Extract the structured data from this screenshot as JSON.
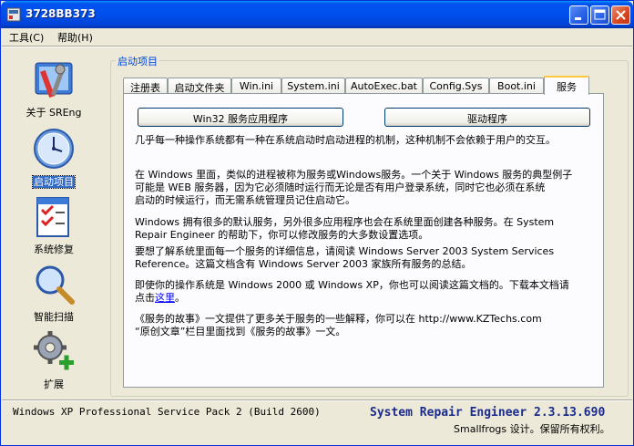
{
  "window": {
    "title": "3728BB373"
  },
  "menu": {
    "tools": "工具(C)",
    "help": "帮助(H)"
  },
  "sidebar": {
    "items": [
      {
        "label": "关于 SREng",
        "icon": "tools-icon"
      },
      {
        "label": "启动项目",
        "icon": "clock-icon"
      },
      {
        "label": "系统修复",
        "icon": "checklist-icon"
      },
      {
        "label": "智能扫描",
        "icon": "magnifier-icon"
      },
      {
        "label": "扩展",
        "icon": "gear-plus-icon"
      }
    ]
  },
  "group": {
    "label": "启动项目"
  },
  "tabs": [
    "注册表",
    "启动文件夹",
    "Win.ini",
    "System.ini",
    "AutoExec.bat",
    "Config.Sys",
    "Boot.ini",
    "服务"
  ],
  "buttons": {
    "win32": "Win32 服务应用程序",
    "driver": "驱动程序"
  },
  "content": {
    "p1": "几乎每一种操作系统都有一种在系统启动时启动进程的机制，这种机制不会依赖于用户的交互。",
    "p2a": "在 Windows 里面，类似的进程被称为服务或Windows服务。一个关于 Windows 服务的典型例子",
    "p2b": "可能是 WEB 服务器，因为它必须随时运行而无论是否有用户登录系统，同时它也必须在系统",
    "p2c": "启动的时候运行，而无需系统管理员记住启动它。",
    "p3a": "Windows 拥有很多的默认服务，另外很多应用程序也会在系统里面创建各种服务。在 System",
    "p3b": "Repair Engineer 的帮助下，你可以修改服务的大多数设置选项。",
    "p4a": "要想了解系统里面每一个服务的详细信息，请阅读 Windows Server 2003 System Services",
    "p4b": "Reference。这篇文档含有 Windows Server 2003 家族所有服务的总结。",
    "p5a": "即使你的操作系统是 Windows 2000 或 Windows XP，你也可以阅读这篇文档的。下载本文档请",
    "p5b_pre": "点击",
    "p5b_link": "这里",
    "p5b_post": "。",
    "p6a": "《服务的故事》一文提供了更多关于服务的一些解释，你可以在 http://www.KZTechs.com",
    "p6b": "“原创文章”栏目里面找到《服务的故事》一文。"
  },
  "status": {
    "os": "Windows XP Professional Service Pack 2 (Build 2600)",
    "app": "System Repair Engineer 2.3.13.690",
    "copyright": "Smallfrogs 设计。保留所有权利。"
  }
}
